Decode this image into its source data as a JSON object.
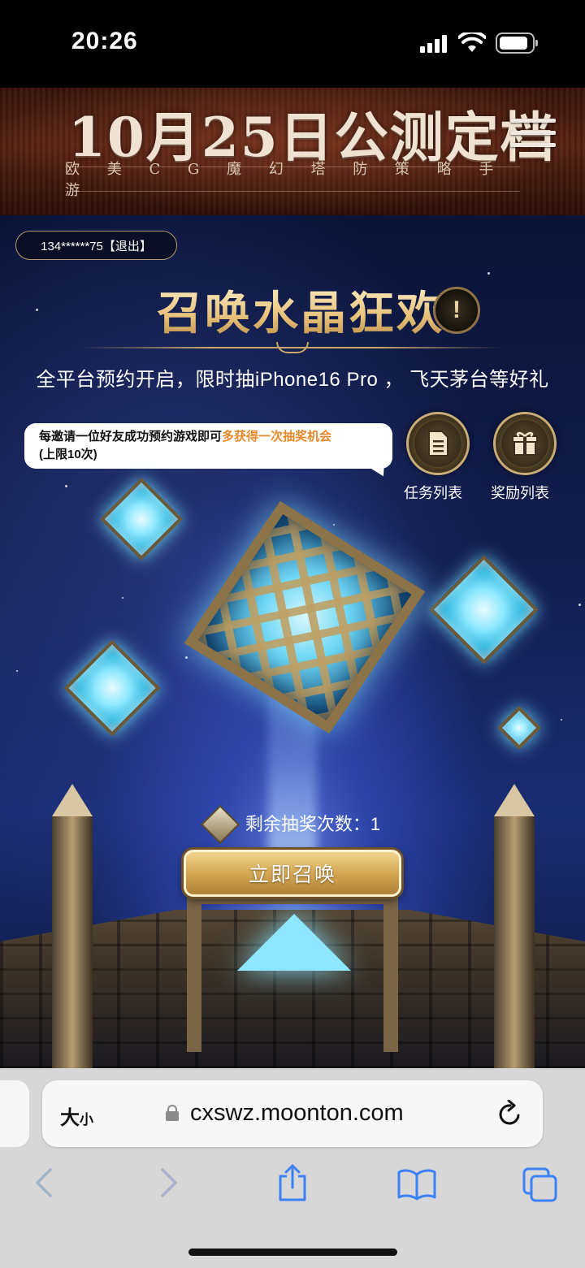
{
  "status_bar": {
    "time": "20:26",
    "icons": [
      "signal-icon",
      "wifi-icon",
      "battery-icon"
    ]
  },
  "banner": {
    "title": "10月25日公测定档",
    "subtitle": "欧 美 C G 魔 幻 塔 防 策 略 手 游",
    "menu_icon": "hamburger-menu-icon"
  },
  "account": {
    "label": "134******75【退出】"
  },
  "event": {
    "title": "召唤水晶狂欢",
    "info_icon": "!",
    "subtitle": "全平台预约开启，限时抽iPhone16 Pro ， 飞天茅台等好礼"
  },
  "invite": {
    "text_prefix": "每邀请一位好友成功预约游戏即可",
    "text_highlight": "多获得一次抽奖机会",
    "text_suffix": "(上限10次)",
    "highlight_color": "#e6892b"
  },
  "actions": {
    "task_list": {
      "label": "任务列表",
      "icon": "document-icon"
    },
    "reward_list": {
      "label": "奖励列表",
      "icon": "gift-icon"
    }
  },
  "draws": {
    "label": "剩余抽奖次数：",
    "count": "1"
  },
  "summon_button": {
    "label": "立即召唤"
  },
  "browser": {
    "text_size_big": "大",
    "text_size_small": "小",
    "url": "cxswz.moonton.com",
    "toolbar": [
      "back-icon",
      "forward-icon",
      "share-icon",
      "bookmarks-icon",
      "tabs-icon"
    ]
  },
  "colors": {
    "gold": "#d4a753",
    "title_gold": "#f4dca8",
    "accent_orange": "#e6892b",
    "browser_bg": "#d7d7d7",
    "ios_blue": "#3b82f6"
  }
}
